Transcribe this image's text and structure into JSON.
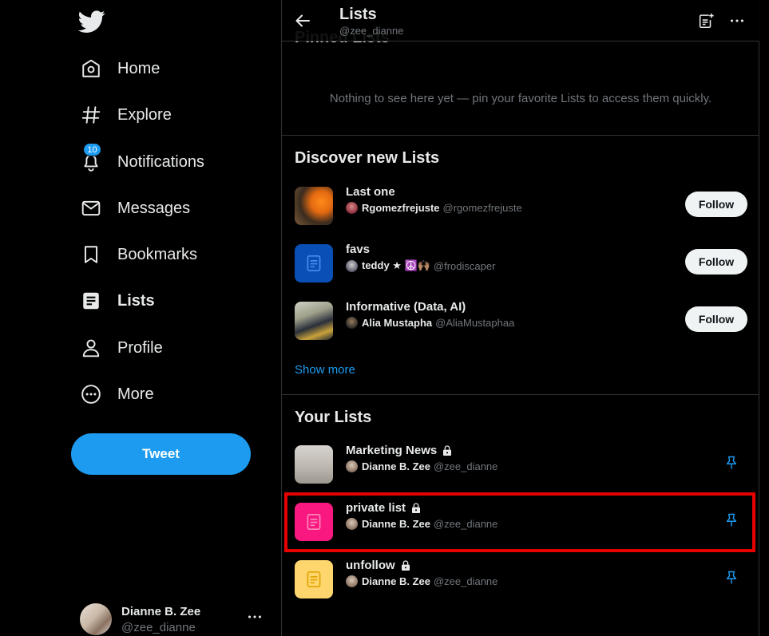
{
  "sidebar": {
    "logo": "twitter-bird-icon",
    "nav": [
      {
        "label": "Home",
        "icon": "home-icon"
      },
      {
        "label": "Explore",
        "icon": "hashtag-icon"
      },
      {
        "label": "Notifications",
        "icon": "bell-icon",
        "badge": "10"
      },
      {
        "label": "Messages",
        "icon": "envelope-icon"
      },
      {
        "label": "Bookmarks",
        "icon": "bookmark-icon"
      },
      {
        "label": "Lists",
        "icon": "lists-icon",
        "active": true
      },
      {
        "label": "Profile",
        "icon": "person-icon"
      },
      {
        "label": "More",
        "icon": "more-circle-icon"
      }
    ],
    "tweet_label": "Tweet",
    "account": {
      "name": "Dianne B. Zee",
      "handle": "@zee_dianne"
    }
  },
  "header": {
    "title": "Lists",
    "subtitle": "@zee_dianne"
  },
  "pinned": {
    "title": "Pinned Lists",
    "empty_message": "Nothing to see here yet — pin your favorite Lists to access them quickly."
  },
  "discover": {
    "title": "Discover new Lists",
    "items": [
      {
        "name": "Last one",
        "owner": "Rgomezfrejuste",
        "handle": "@rgomezfrejuste",
        "follow_label": "Follow"
      },
      {
        "name": "favs",
        "owner": "teddy ★ ☮️🙌🏽",
        "handle": "@frodiscaper",
        "follow_label": "Follow"
      },
      {
        "name": "Informative (Data, AI)",
        "owner": "Alia Mustapha",
        "handle": "@AliaMustaphaa",
        "follow_label": "Follow"
      }
    ],
    "show_more": "Show more"
  },
  "your_lists": {
    "title": "Your Lists",
    "items": [
      {
        "name": "Marketing News",
        "owner": "Dianne B. Zee",
        "handle": "@zee_dianne",
        "private": true
      },
      {
        "name": "private list",
        "owner": "Dianne B. Zee",
        "handle": "@zee_dianne",
        "private": true
      },
      {
        "name": "unfollow",
        "owner": "Dianne B. Zee",
        "handle": "@zee_dianne",
        "private": true
      }
    ]
  },
  "colors": {
    "accent": "#1d9bf0",
    "favs_thumb": "#0a4fb5",
    "private_thumb": "#f91880",
    "unfollow_thumb": "#ffd66e",
    "highlight": "#e60000"
  }
}
